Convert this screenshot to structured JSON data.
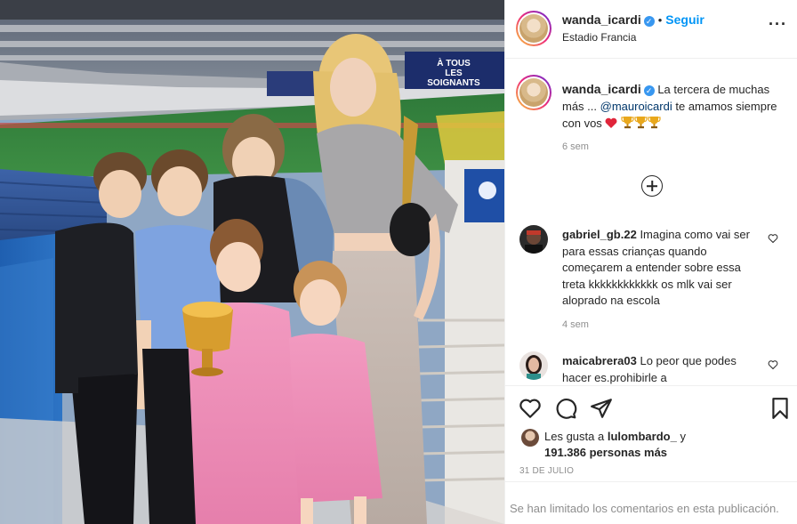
{
  "post_header": {
    "username": "wanda_icardi",
    "separator": "•",
    "follow_label": "Seguir",
    "location": "Estadio Francia",
    "more_icon": "more-options-icon"
  },
  "photo": {
    "banner_lines": [
      "À TOUS",
      "LES",
      "SOIGNANTS"
    ]
  },
  "caption": {
    "username": "wanda_icardi",
    "text_before": "La tercera de muchas más ... ",
    "mention": "@mauroicardi",
    "text_after": " te amamos siempre con vos ",
    "emojis": [
      "heart-emoji",
      "trophy-emoji",
      "trophy-emoji",
      "trophy-emoji"
    ],
    "time": "6 sem"
  },
  "load_more_icon": "add-circle-icon",
  "comments": [
    {
      "username": "gabriel_gb.22",
      "text": "Imagina como vai ser para essas crianças quando começarem a entender sobre essa treta kkkkkkkkkkkk os mlk vai ser aloprado na escola",
      "time": "4 sem"
    },
    {
      "username": "maicabrera03",
      "text": "Lo peor que podes hacer es.prohibirle a",
      "time": ""
    }
  ],
  "actions": {
    "icons": [
      "like-heart-icon",
      "comment-icon",
      "share-icon",
      "save-bookmark-icon"
    ],
    "likes_prefix": "Les gusta a ",
    "likes_user": "lulombardo_",
    "likes_connector": " y",
    "likes_count": "191.386 personas más",
    "date": "31 DE JULIO"
  },
  "comments_limited": "Se han limitado los comentarios en esta publicación.",
  "colors": {
    "accent_blue": "#0095f6",
    "verified_blue": "#3897f0",
    "mention": "#00376b",
    "muted": "#8e8e8e",
    "heart_red": "#ed4956"
  }
}
